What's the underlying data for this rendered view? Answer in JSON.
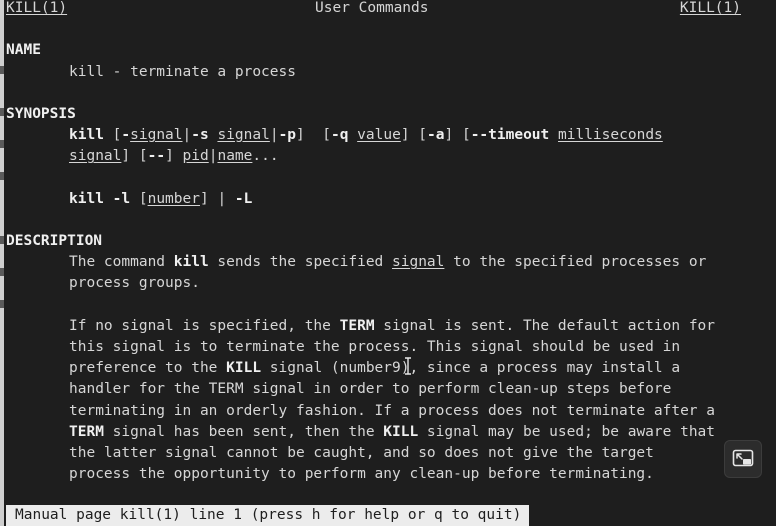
{
  "header": {
    "left": "KILL(1)",
    "center": "User Commands",
    "right": "KILL(1)"
  },
  "sections": {
    "name": {
      "heading": "NAME",
      "line": "kill - terminate a process"
    },
    "synopsis": {
      "heading": "SYNOPSIS",
      "l1": {
        "cmd": "kill",
        "t1": " [",
        "o_dash": "-",
        "a_signal": "signal",
        "p1": "|",
        "o_s": "-s",
        "sp1": " ",
        "a_signal2": "signal",
        "p2": "|",
        "o_p": "-p",
        "t2": "]  [",
        "o_q": "-q",
        "sp2": " ",
        "a_value": "value",
        "t3": "] [",
        "o_a": "-a",
        "t4": "] [",
        "o_timeout": "--timeout",
        "sp3": " ",
        "a_ms": "milliseconds"
      },
      "l2": {
        "a_signal": "signal",
        "t1": "] [",
        "o_dd": "--",
        "t2": "] ",
        "a_pid": "pid",
        "p1": "|",
        "a_name": "name",
        "t3": "..."
      },
      "l3": {
        "cmd": "kill",
        "sp1": " ",
        "o_l": "-l",
        "t1": " [",
        "a_number": "number",
        "t2": "] | ",
        "o_L": "-L"
      }
    },
    "description": {
      "heading": "DESCRIPTION",
      "p1": {
        "l1_a": "The command ",
        "l1_kill": "kill",
        "l1_b": " sends the specified ",
        "l1_signal": "signal",
        "l1_c": " to the specified processes or",
        "l2": "process groups."
      },
      "p2": {
        "l1_a": "If no signal is specified, the ",
        "l1_term": "TERM",
        "l1_b": " signal is sent. The default action for",
        "l2": "this signal is to terminate the process. This signal should be used in",
        "l3_a": "preference to the ",
        "l3_kill": "KILL",
        "l3_b": " signal (number",
        "l3_c": "9), since a process may install a",
        "l4": "handler for the TERM signal in order to perform clean-up steps before",
        "l5": "terminating in an orderly fashion. If a process does not terminate after a",
        "l6_term": "TERM",
        "l6_a": " signal has been sent, then the ",
        "l6_kill": "KILL",
        "l6_b": " signal may be used; be aware that",
        "l7": "the latter signal cannot be caught, and so does not give the target",
        "l8": "process the opportunity to perform any clean-up before terminating."
      }
    }
  },
  "status_bar": {
    "text": "Manual page kill(1) line 1 (press h for help or q to quit)"
  },
  "icons": {
    "fab": "picture-in-picture-icon",
    "cursor": "text-cursor-icon"
  },
  "colors": {
    "background": "#1e1e1e",
    "text": "#d6d6d6",
    "bold": "#f0f0f0",
    "status_bg": "#ececec"
  }
}
